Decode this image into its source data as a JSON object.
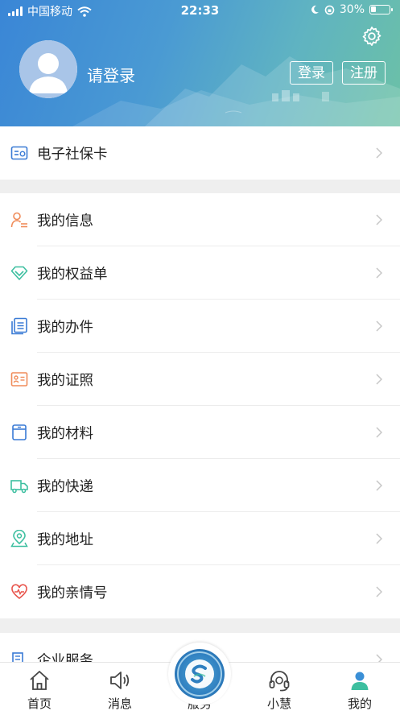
{
  "status_bar": {
    "carrier": "中国移动",
    "time": "22:33",
    "battery": "30%",
    "battery_fraction": 0.3
  },
  "header": {
    "login_prompt": "请登录",
    "login_button": "登录",
    "register_button": "注册"
  },
  "social_card": {
    "label": "电子社保卡"
  },
  "menu": [
    {
      "label": "我的信息",
      "icon": "user-info-icon"
    },
    {
      "label": "我的权益单",
      "icon": "diamond-icon"
    },
    {
      "label": "我的办件",
      "icon": "documents-icon"
    },
    {
      "label": "我的证照",
      "icon": "id-card-icon"
    },
    {
      "label": "我的材料",
      "icon": "folder-icon"
    },
    {
      "label": "我的快递",
      "icon": "truck-icon"
    },
    {
      "label": "我的地址",
      "icon": "location-icon"
    },
    {
      "label": "我的亲情号",
      "icon": "heart-icon"
    }
  ],
  "enterprise": {
    "label": "企业服务"
  },
  "bottom_nav": {
    "home": "首页",
    "messages": "消息",
    "service": "服务",
    "assistant": "小慧",
    "mine": "我的"
  },
  "colors": {
    "accent": "#4a90d9",
    "orange": "#f08c5a",
    "teal": "#3dbfa0",
    "red": "#e8524a"
  }
}
